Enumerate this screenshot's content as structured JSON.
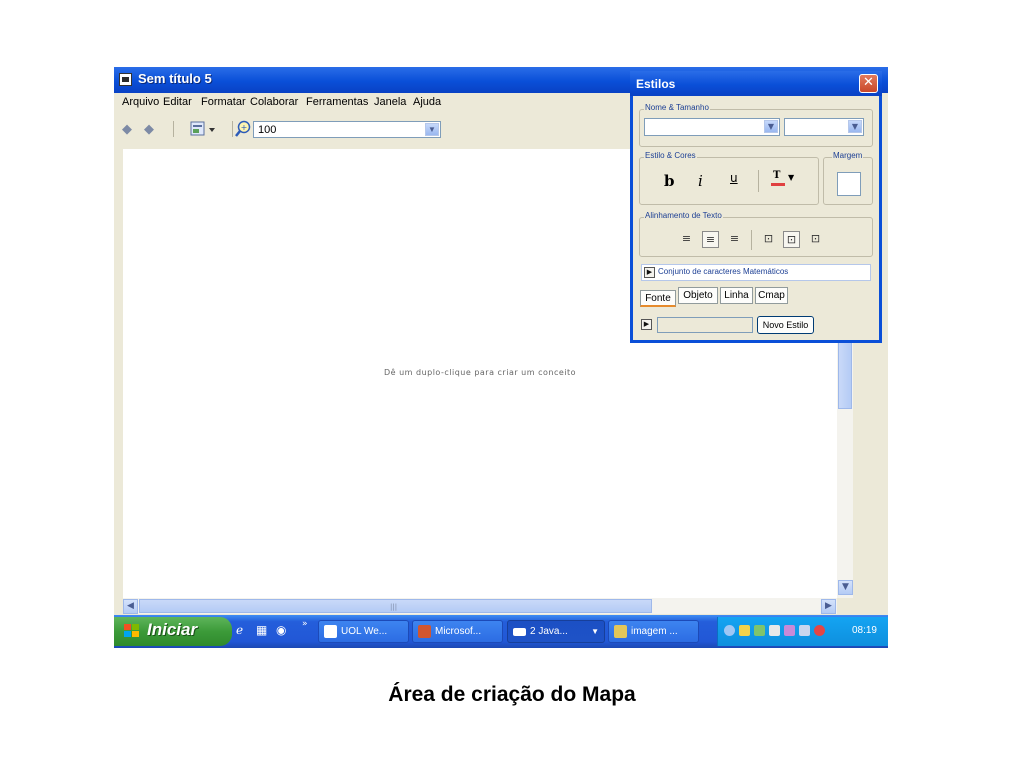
{
  "window": {
    "title": "Sem título 5"
  },
  "menu": [
    "Arquivo",
    "Editar",
    "Formatar",
    "Colaborar",
    "Ferramentas",
    "Janela",
    "Ajuda"
  ],
  "toolbar": {
    "zoom_value": "100"
  },
  "canvas": {
    "hint": "Dê um duplo-clique para criar um conceito"
  },
  "styles_panel": {
    "title": "Estilos",
    "group_name_size": "Nome & Tamanho",
    "group_style_colors": "Estilo & Cores",
    "group_margin": "Margem",
    "bold": "b",
    "italic": "i",
    "underline": "u",
    "font_color_glyph": "T",
    "group_alignment": "Alinhamento de Texto",
    "math_charset": "Conjunto de caracteres Matemáticos",
    "tabs": [
      "Fonte",
      "Objeto",
      "Linha",
      "Cmap"
    ],
    "new_style_button": "Novo Estilo"
  },
  "taskbar": {
    "start_label": "Iniciar",
    "tasks": [
      "UOL We...",
      "Microsof...",
      "2 Java...",
      "imagem ..."
    ],
    "clock": "08:19"
  },
  "caption": "Área de criação do Mapa"
}
